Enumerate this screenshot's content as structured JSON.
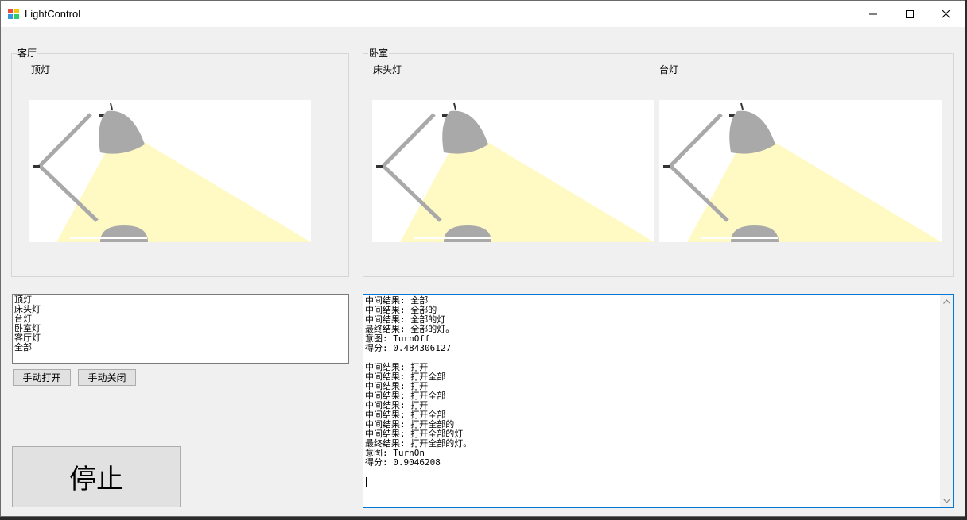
{
  "window": {
    "title": "LightControl"
  },
  "living_room": {
    "group_label": "客厅",
    "lamps": [
      {
        "label": "顶灯"
      }
    ]
  },
  "bedroom": {
    "group_label": "卧室",
    "lamps": [
      {
        "label": "床头灯"
      },
      {
        "label": "台灯"
      }
    ]
  },
  "commands": {
    "items": [
      "顶灯",
      "床头灯",
      "台灯",
      "卧室灯",
      "客厅灯",
      "全部"
    ]
  },
  "buttons": {
    "manual_on": "手动打开",
    "manual_off": "手动关闭",
    "stop": "停止"
  },
  "log": {
    "lines": [
      "中间结果: 全部",
      "中间结果: 全部的",
      "中间结果: 全部的灯",
      "最终结果: 全部的灯。",
      "意图: TurnOff",
      "得分: 0.484306127",
      "",
      "中间结果: 打开",
      "中间结果: 打开全部",
      "中间结果: 打开",
      "中间结果: 打开全部",
      "中间结果: 打开",
      "中间结果: 打开全部",
      "中间结果: 打开全部的",
      "中间结果: 打开全部的灯",
      "最终结果: 打开全部的灯。",
      "意图: TurnOn",
      "得分: 0.9046208"
    ]
  },
  "colors": {
    "light_beam": "#fff9c4",
    "lamp_gray": "#a9a9a9",
    "focus_border": "#0078d7"
  }
}
